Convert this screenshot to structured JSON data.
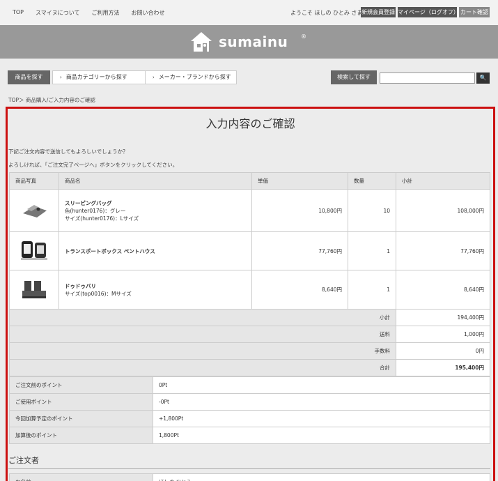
{
  "topnav": {
    "links": [
      "TOP",
      "スマイヌについて",
      "ご利用方法",
      "お問い合わせ"
    ],
    "welcome": "ようこそ ほしの ひとみ さま",
    "register": "新規会員登録",
    "mypage": "マイページ（ログオフ）",
    "cart": "カート確認"
  },
  "header": {
    "logo_text": "sumainu",
    "logo_mark": "®"
  },
  "searchbar": {
    "find": "商品を探す",
    "by_category": "商品カテゴリーから探す",
    "by_maker": "メーカー・ブランドから探す",
    "search_button": "検索して探す",
    "search_value": "",
    "go": "🔍"
  },
  "breadcrumb": "TOP＞ 商品購入/ご入力内容のご確認",
  "page": {
    "title": "入力内容のご確認",
    "intro1": "下記ご注文内容で送信してもよろしいでしょうか？",
    "intro2": "よろしければ、「ご注文完了ページへ」ボタンをクリックしてください。"
  },
  "items_table": {
    "headers": [
      "商品写真",
      "商品名",
      "単価",
      "数量",
      "小計"
    ],
    "rows": [
      {
        "name": "スリーピングバッグ",
        "opt1": "色(hunter0176)：グレー",
        "opt2": "サイズ(hunter0176)：Lサイズ",
        "price": "10,800円",
        "qty": "10",
        "subtotal": "108,000円"
      },
      {
        "name": "トランスポートボックス ペントハウス",
        "opt1": "",
        "opt2": "",
        "price": "77,760円",
        "qty": "1",
        "subtotal": "77,760円"
      },
      {
        "name": "ドゥドゥバリ",
        "opt1": "サイズ(top0016)：Mサイズ",
        "opt2": "",
        "price": "8,640円",
        "qty": "1",
        "subtotal": "8,640円"
      }
    ],
    "summary": [
      {
        "label": "小計",
        "value": "194,400円"
      },
      {
        "label": "送料",
        "value": "1,000円"
      },
      {
        "label": "手数料",
        "value": "0円"
      },
      {
        "label": "合計",
        "value": "195,400円"
      }
    ]
  },
  "points": [
    {
      "label": "ご注文前のポイント",
      "value": "0Pt"
    },
    {
      "label": "ご使用ポイント",
      "value": "-0Pt"
    },
    {
      "label": "今回加算予定のポイント",
      "value": "+1,800Pt"
    },
    {
      "label": "加算後のポイント",
      "value": "1,800Pt"
    }
  ],
  "customer": {
    "section_title": "ご注文者",
    "rows": [
      {
        "label": "お名前",
        "value": "ほしの ひとみ"
      }
    ]
  },
  "colors": {
    "accent": "#cc1111",
    "header_band": "#999999",
    "button_dark": "#666666"
  }
}
